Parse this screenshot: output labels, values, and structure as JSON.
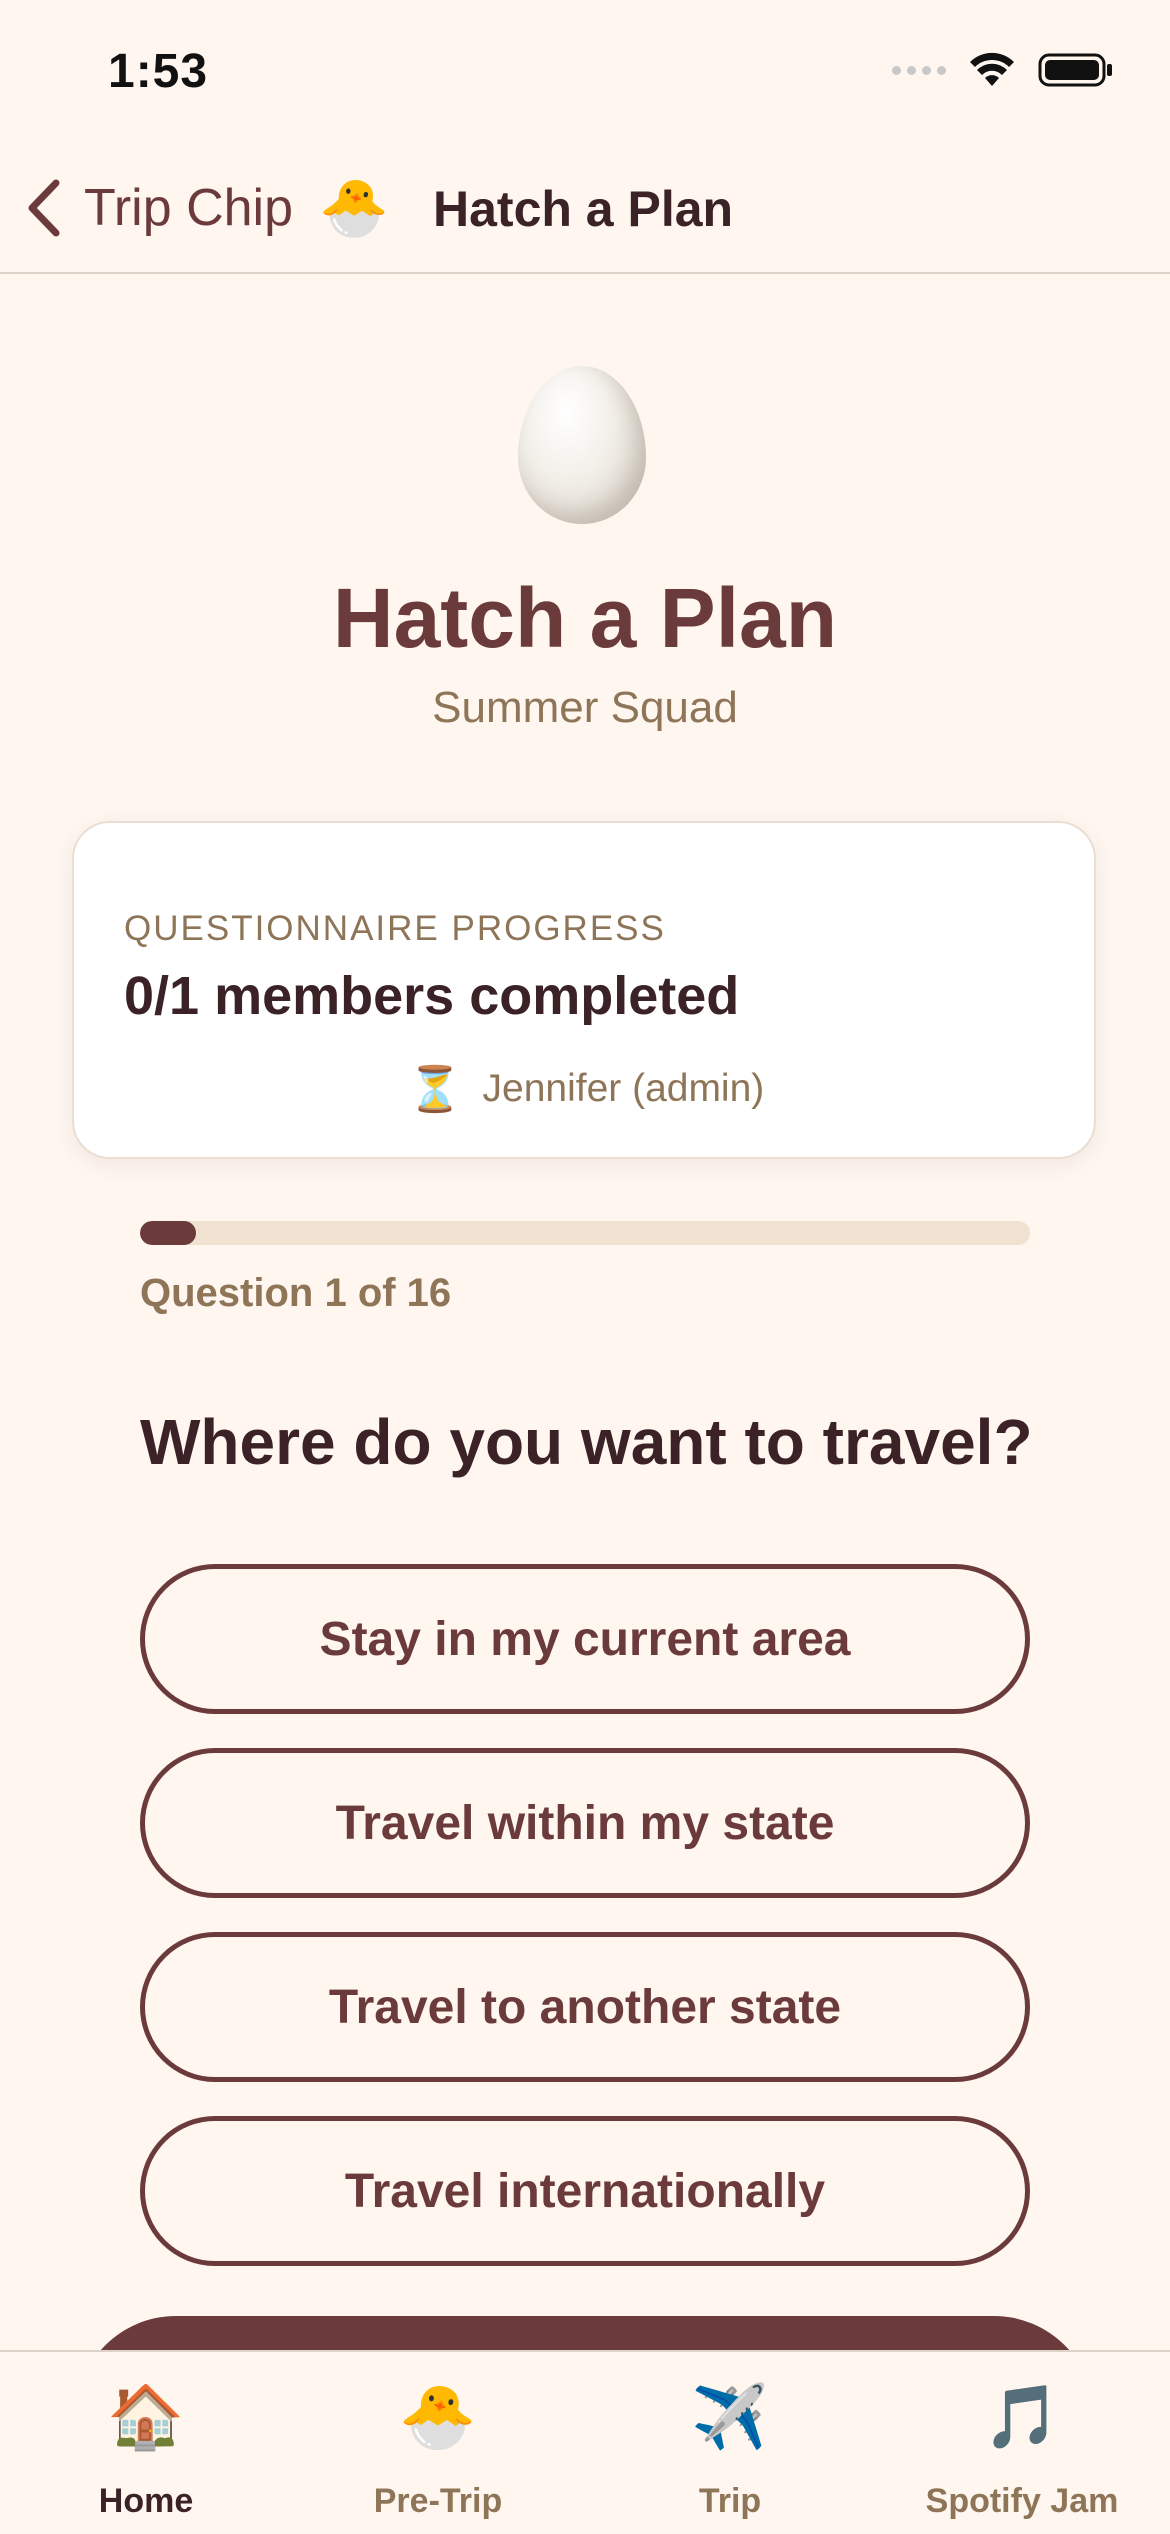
{
  "status_bar": {
    "time": "1:53"
  },
  "nav": {
    "back_label": "Trip Chip",
    "back_emoji": "🐣",
    "title": "Hatch a Plan"
  },
  "hero": {
    "title": "Hatch a Plan",
    "subtitle": "Summer Squad",
    "icon": "egg-icon"
  },
  "progress_card": {
    "label": "QUESTIONNAIRE PROGRESS",
    "count": "0/1 members completed",
    "members": [
      {
        "status_icon": "⏳",
        "name": "Jennifer (admin)"
      }
    ]
  },
  "question_progress": {
    "label": "Question 1 of 16",
    "current": 1,
    "total": 16
  },
  "question": {
    "text": "Where do you want to travel?",
    "options": [
      "Stay in my current area",
      "Travel within my state",
      "Travel to another state",
      "Travel internationally"
    ]
  },
  "tab_bar": {
    "tabs": [
      {
        "icon": "🏠",
        "label": "Home",
        "active": true
      },
      {
        "icon": "🐣",
        "label": "Pre-Trip",
        "active": false
      },
      {
        "icon": "✈️",
        "label": "Trip",
        "active": false
      },
      {
        "icon": "🎵",
        "label": "Spotify Jam",
        "active": false
      }
    ]
  },
  "colors": {
    "background": "#FEF6EF",
    "accent": "#6B3A3B",
    "muted": "#8E7558",
    "track": "#F1E1D1"
  }
}
